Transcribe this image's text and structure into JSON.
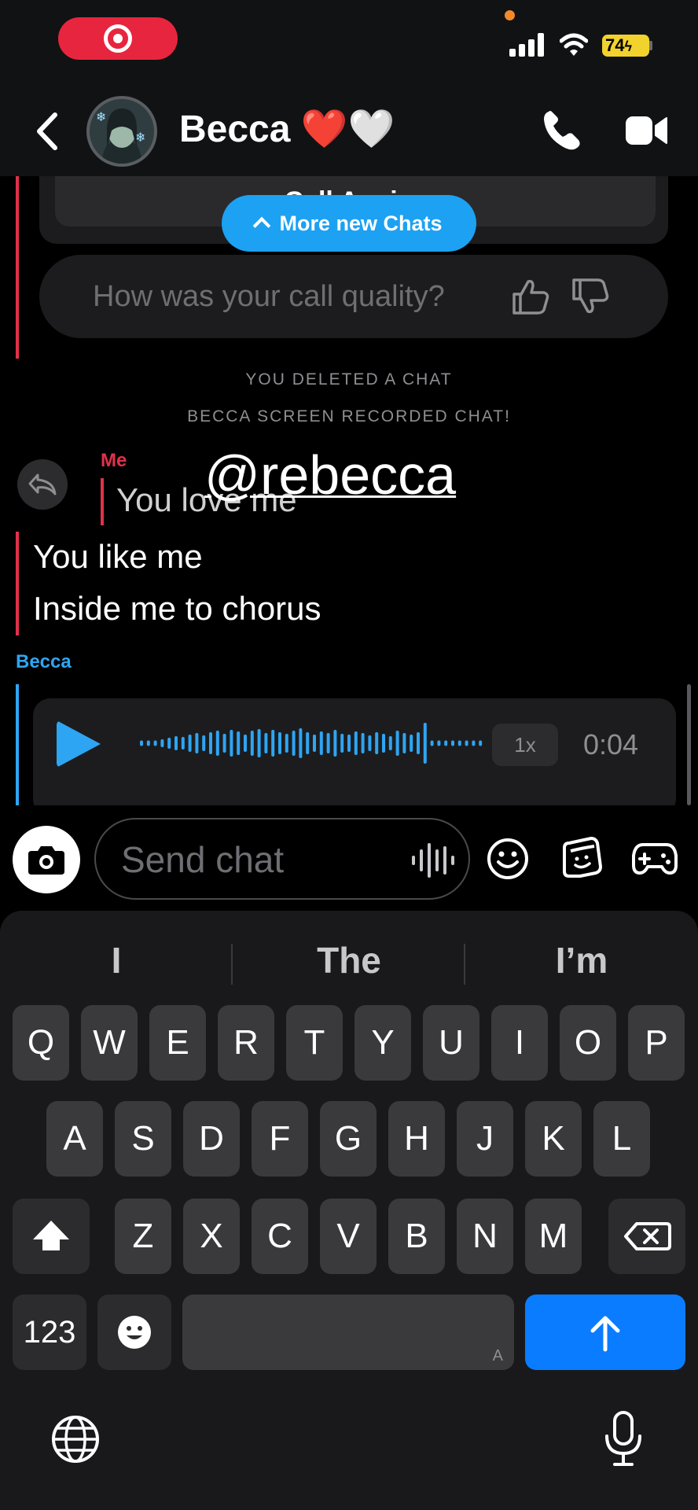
{
  "status_bar": {
    "battery": "74",
    "recording_indicator_icon": "target-icon"
  },
  "header": {
    "title": "Becca ❤️🤍",
    "back_icon": "chevron-left-icon",
    "call_icon": "phone-icon",
    "video_icon": "video-camera-icon"
  },
  "chat": {
    "call_again_label": "Call Again",
    "new_chats_pill": "More new Chats",
    "call_quality_prompt": "How was your call quality?",
    "system_messages": [
      "YOU DELETED A CHAT",
      "BECCA SCREEN RECORDED CHAT!"
    ],
    "me_label": "Me",
    "quoted_text": "You love me",
    "mention_overlay": "@rebecca",
    "messages": [
      "You like me",
      "Inside me to chorus"
    ],
    "becca_label": "Becca",
    "voice_note": {
      "speed": "1x",
      "duration": "0:04",
      "accent": "#2ea5f3"
    }
  },
  "composer": {
    "placeholder": "Send chat",
    "camera_icon": "camera-icon",
    "mic_icon": "voice-wave-icon",
    "emoji_icon": "smiley-icon",
    "sticker_icon": "sticker-icon",
    "games_icon": "game-controller-icon"
  },
  "keyboard": {
    "suggestions": [
      "I",
      "The",
      "I’m"
    ],
    "row1": [
      "Q",
      "W",
      "E",
      "R",
      "T",
      "Y",
      "U",
      "I",
      "O",
      "P"
    ],
    "row2": [
      "A",
      "S",
      "D",
      "F",
      "G",
      "H",
      "J",
      "K",
      "L"
    ],
    "row3": [
      "Z",
      "X",
      "C",
      "V",
      "B",
      "N",
      "M"
    ],
    "numbers_key": "123",
    "space_sub": "A",
    "shift_icon": "shift-arrow-icon",
    "delete_icon": "backspace-icon",
    "send_icon": "arrow-up-icon",
    "globe_icon": "globe-icon",
    "dictation_icon": "microphone-icon"
  },
  "colors": {
    "me_red": "#e1314b",
    "friend_blue": "#2ea5f3",
    "send_blue": "#0a7cff"
  }
}
